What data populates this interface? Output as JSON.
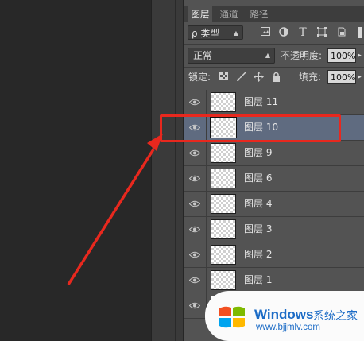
{
  "tabs": [
    "图层",
    "通道",
    "路径"
  ],
  "filter": {
    "label": "ρ 类型",
    "icons": [
      "image-filter-icon",
      "adjustment-filter-icon",
      "type-filter-icon",
      "shape-filter-icon",
      "smart-object-filter-icon"
    ]
  },
  "blend": {
    "mode": "正常",
    "opacity_label": "不透明度:",
    "opacity": "100%"
  },
  "lock": {
    "label": "锁定:",
    "fill_label": "填充:",
    "fill": "100%"
  },
  "layers": [
    {
      "name": "图层 11",
      "selected": false
    },
    {
      "name": "图层 10",
      "selected": true
    },
    {
      "name": "图层 9",
      "selected": false
    },
    {
      "name": "图层 6",
      "selected": false
    },
    {
      "name": "图层 4",
      "selected": false
    },
    {
      "name": "图层 3",
      "selected": false
    },
    {
      "name": "图层 2",
      "selected": false
    },
    {
      "name": "图层 1",
      "selected": false
    },
    {
      "name": "",
      "selected": false
    }
  ],
  "watermark": {
    "title": "Windows",
    "subtitle": "系统之家",
    "url": "www.bjjmlv.com"
  },
  "colors": {
    "annotation": "#e8281e",
    "selected_row": "#5f6b80",
    "watermark_text": "#1b6bc6"
  }
}
